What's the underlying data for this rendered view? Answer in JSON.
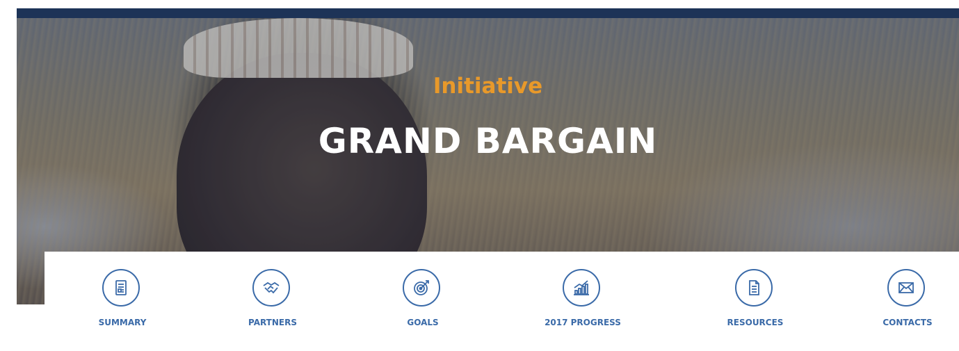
{
  "hero": {
    "subtitle": "Initiative",
    "title": "GRAND BARGAIN"
  },
  "nav": {
    "items": [
      {
        "label": "SUMMARY",
        "icon": "document-icon"
      },
      {
        "label": "PARTNERS",
        "icon": "handshake-icon"
      },
      {
        "label": "GOALS",
        "icon": "target-icon"
      },
      {
        "label": "2017 PROGRESS",
        "icon": "bar-chart-icon"
      },
      {
        "label": "RESOURCES",
        "icon": "file-icon"
      },
      {
        "label": "CONTACTS",
        "icon": "envelope-icon"
      }
    ]
  },
  "colors": {
    "top_bar": "#1d3357",
    "accent_orange": "#e8992a",
    "nav_blue": "#3a6aa8"
  }
}
